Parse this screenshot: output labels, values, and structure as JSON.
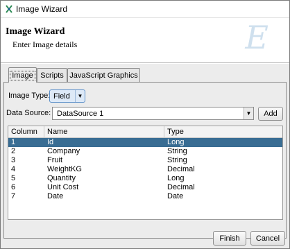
{
  "window": {
    "title": "Image Wizard",
    "icon": "wizard-app-icon"
  },
  "banner": {
    "title": "Image Wizard",
    "subtitle": "Enter Image details",
    "logo_letter": "E"
  },
  "tabs": [
    {
      "label": "Image",
      "active": true
    },
    {
      "label": "Scripts",
      "active": false
    },
    {
      "label": "JavaScript Graphics",
      "active": false
    }
  ],
  "form": {
    "image_type_label": "Image Type:",
    "image_type_value": "Field",
    "data_source_label": "Data Source:",
    "data_source_value": "DataSource 1",
    "add_label": "Add"
  },
  "table": {
    "columns": [
      "Column",
      "Name",
      "Type"
    ],
    "rows": [
      [
        "1",
        "Id",
        "Long"
      ],
      [
        "2",
        "Company",
        "String"
      ],
      [
        "3",
        "Fruit",
        "String"
      ],
      [
        "4",
        "WeightKG",
        "Decimal"
      ],
      [
        "5",
        "Quantity",
        "Long"
      ],
      [
        "6",
        "Unit Cost",
        "Decimal"
      ],
      [
        "7",
        "Date",
        "Date"
      ]
    ],
    "selected_row": 0
  },
  "footer": {
    "finish_label": "Finish",
    "cancel_label": "Cancel"
  },
  "colors": {
    "selection": "#396d93",
    "focus_combo": "#dde9f7"
  }
}
